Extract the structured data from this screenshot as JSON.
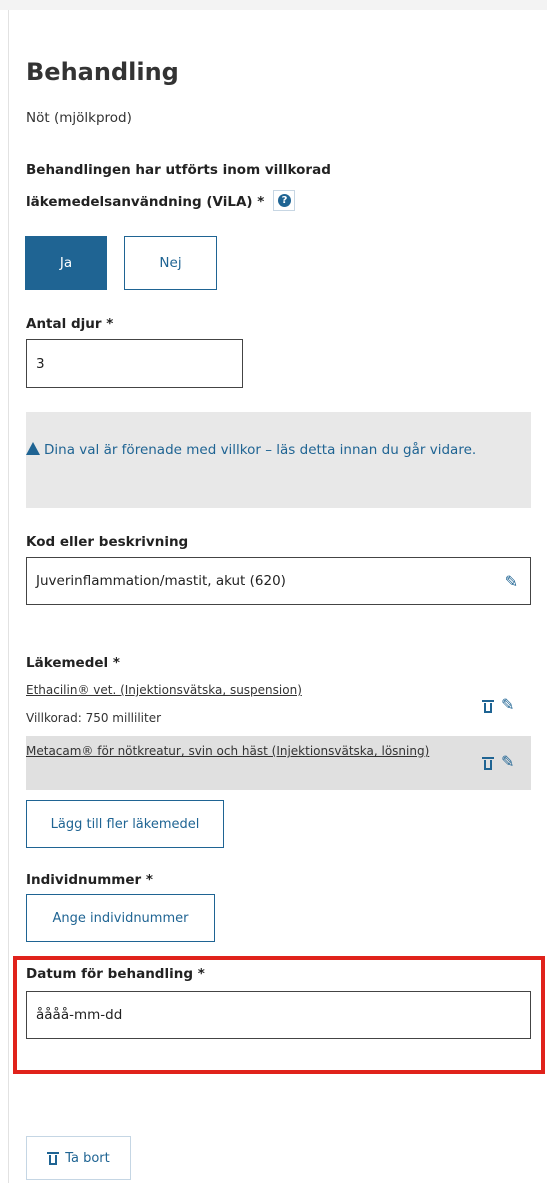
{
  "page": {
    "title": "Behandling",
    "animal_type": "Nöt (mjölkprod)"
  },
  "vila": {
    "question": "Behandlingen har utförts inom villkorad läkemedelsanvändning (ViLA) *",
    "help_icon": "?",
    "yes_label": "Ja",
    "no_label": "Nej",
    "selected": "Ja"
  },
  "antal_djur": {
    "label": "Antal djur *",
    "value": "3"
  },
  "alert": {
    "text": "Dina val är förenade med villkor – läs detta innan du går vidare."
  },
  "kod": {
    "label": "Kod eller beskrivning",
    "value": "Juverinflammation/mastit, akut (620)"
  },
  "lakemedel": {
    "label": "Läkemedel *",
    "items": [
      {
        "name": "Ethacilin® vet. (Injektionsvätska, suspension)",
        "detail": "Villkorad: 750 milliliter"
      },
      {
        "name": "Metacam® för nötkreatur, svin och häst (Injektionsvätska, lösning)",
        "detail": ""
      }
    ],
    "add_label": "Lägg till fler läkemedel"
  },
  "individnummer": {
    "label": "Individnummer *",
    "button_label": "Ange individnummer"
  },
  "datum": {
    "label": "Datum för behandling *",
    "placeholder": "åååå-mm-dd"
  },
  "actions": {
    "delete_label": "Ta bort"
  },
  "colors": {
    "primary": "#1f6493",
    "highlight": "#e0221b",
    "alert_bg": "#e8e8e8"
  }
}
